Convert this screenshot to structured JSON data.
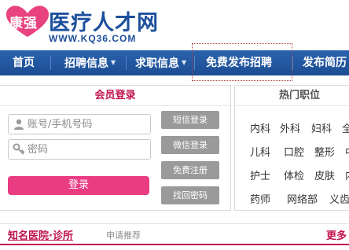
{
  "logo": {
    "brand": "康强",
    "title": "医疗人才网",
    "url": "WWW.KQ36.COM"
  },
  "nav": {
    "items": [
      {
        "label": "首页",
        "has_caret": false
      },
      {
        "label": "招聘信息",
        "has_caret": true
      },
      {
        "label": "求职信息",
        "has_caret": true
      },
      {
        "label": "免费发布招聘",
        "has_caret": false
      },
      {
        "label": "发布简历",
        "has_caret": false
      }
    ]
  },
  "login": {
    "title": "会员登录",
    "account_placeholder": "账号/手机号码",
    "password_placeholder": "密码",
    "submit_label": "登录",
    "side_buttons": [
      "短信登录",
      "微信登录",
      "免费注册",
      "找回密码"
    ]
  },
  "hot": {
    "title": "热门职位",
    "rows": [
      [
        "内科",
        "外科",
        "妇科",
        "全"
      ],
      [
        "儿科",
        "口腔",
        "整形",
        "中"
      ],
      [
        "护士",
        "体检",
        "皮肤",
        "内"
      ],
      [
        "药师",
        "网络部",
        "义齿"
      ]
    ]
  },
  "bottom": {
    "title": "知名医院·诊所",
    "apply_label": "申请推荐",
    "more_label": "更多"
  },
  "colors": {
    "brand_blue": "#1c4f9c",
    "nav_blue": "#1c4d93",
    "accent_red": "#c0134b",
    "login_pink": "#ea3c83",
    "heart_pink": "#e8437e",
    "side_button_gray": "#9a9a9a"
  }
}
